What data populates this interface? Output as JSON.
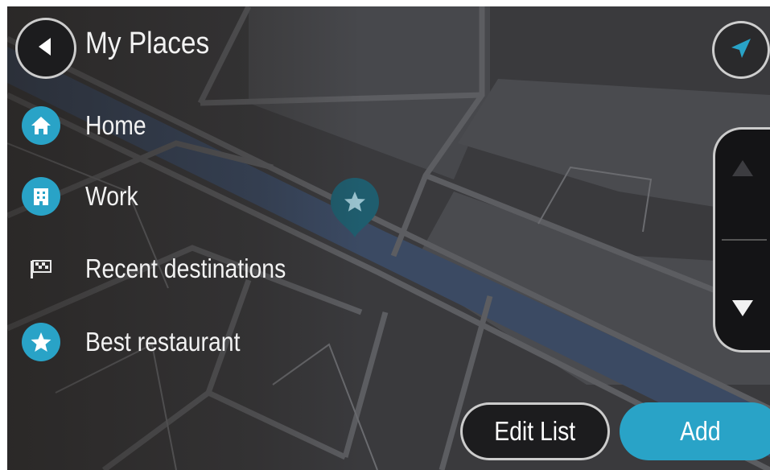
{
  "header": {
    "title": "My Places",
    "back_icon": "back-arrow-icon",
    "nav_icon": "navigation-arrow-icon"
  },
  "places": [
    {
      "label": "Home",
      "icon": "home-icon"
    },
    {
      "label": "Work",
      "icon": "work-icon"
    },
    {
      "label": "Recent destinations",
      "icon": "checkered-flag-icon"
    },
    {
      "label": "Best restaurant",
      "icon": "star-icon"
    }
  ],
  "scroll": {
    "up_icon": "scroll-up-icon",
    "down_icon": "scroll-down-icon"
  },
  "actions": {
    "edit_label": "Edit List",
    "add_label": "Add"
  },
  "map": {
    "pin_icon": "star-location-pin-icon"
  },
  "colors": {
    "accent": "#29a3c7",
    "map_bg": "#3b3b3d",
    "road": "#55565a",
    "water": "#3b4a63"
  }
}
